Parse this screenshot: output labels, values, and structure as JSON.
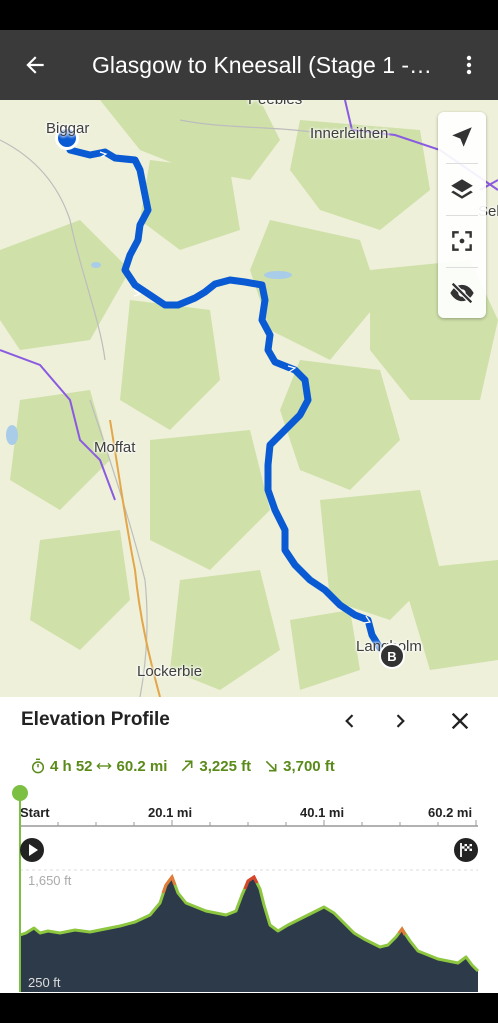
{
  "app_bar": {
    "title": "Glasgow to Kneesall (Stage 1 -…",
    "back_icon": "arrow-left-icon",
    "more_icon": "more-vertical-icon"
  },
  "map": {
    "places": {
      "biggar": "Biggar",
      "peebles": "Peebles",
      "innerleithen": "Innerleithen",
      "selkirk": "Selk",
      "moffat": "Moffat",
      "lockerbie": "Lockerbie",
      "langholm": "Langholm"
    },
    "end_marker": "B",
    "controls": [
      "navigate-icon",
      "layers-icon",
      "focus-icon",
      "hide-icon"
    ],
    "colors": {
      "route": "#0a5ad4",
      "forest": "#cfe0a9",
      "land": "#eef0d9",
      "boundary": "#8a5be0"
    }
  },
  "elevation": {
    "title": "Elevation Profile",
    "prev_icon": "chevron-left-icon",
    "next_icon": "chevron-right-icon",
    "close_icon": "close-icon",
    "duration": "4 h 52",
    "distance": "60.2 mi",
    "ascent": "3,225 ft",
    "descent": "3,700 ft",
    "axis": [
      "Start",
      "20.1 mi",
      "40.1 mi",
      "60.2 mi"
    ],
    "elev_max": "1,650 ft",
    "elev_min": "250 ft",
    "colors": {
      "accent": "#5a8a1a",
      "profile_fill": "#2d3a4a",
      "profile_line": "#8dc63f"
    }
  }
}
